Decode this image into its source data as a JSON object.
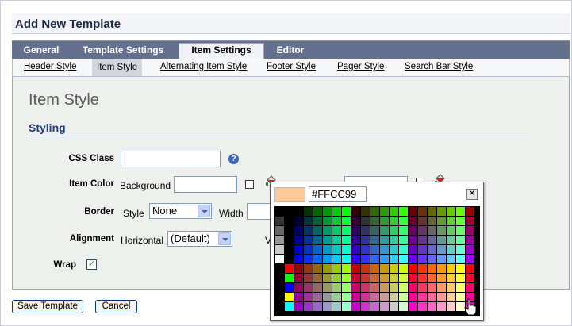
{
  "window": {
    "title": "Add New Template"
  },
  "tabs": [
    "General",
    "Template Settings",
    "Item Settings",
    "Editor"
  ],
  "active_tab": "Item Settings",
  "subtabs": [
    "Header Style",
    "Item Style",
    "Alternating Item Style",
    "Footer Style",
    "Pager Style",
    "Search Bar Style"
  ],
  "active_subtab": "Item Style",
  "section": {
    "title": "Item Style",
    "group": "Styling"
  },
  "form": {
    "css_class": {
      "label": "CSS Class",
      "value": ""
    },
    "item_color": {
      "label": "Item Color",
      "background_label": "Background",
      "background_value": ""
    },
    "border": {
      "label": "Border",
      "style_label": "Style",
      "style_value": "None",
      "width_label": "Width"
    },
    "alignment": {
      "label": "Alignment",
      "horizontal_label": "Horizontal",
      "horizontal_value": "(Default)",
      "vertical_label_partial": "Ve"
    },
    "wrap": {
      "label": "Wrap",
      "checked": true,
      "check_glyph": "✓"
    }
  },
  "picker": {
    "hex": "#FFCC99",
    "preview_color": "#FFCC99",
    "close_glyph": "✕"
  },
  "buttons": {
    "save": "Save Template",
    "cancel": "Cancel"
  },
  "icons": {
    "help": "?"
  }
}
